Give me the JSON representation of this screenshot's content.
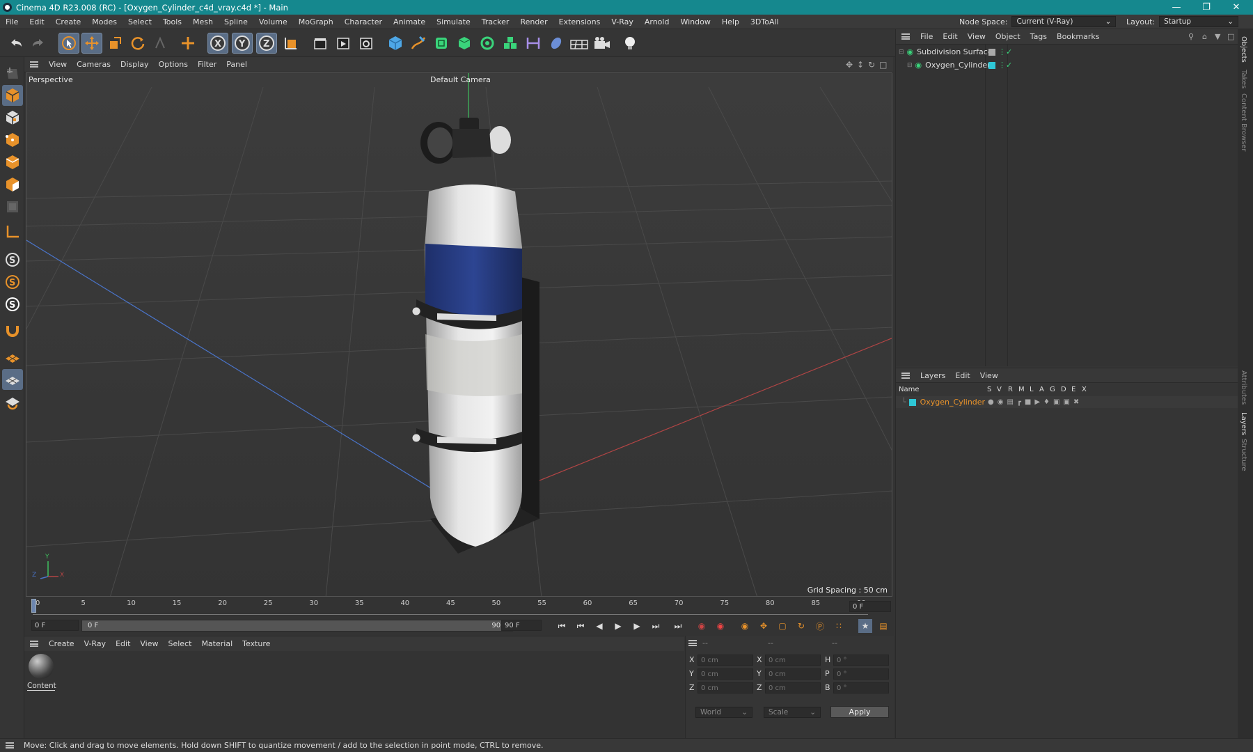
{
  "window": {
    "title": "Cinema 4D R23.008 (RC) - [Oxygen_Cylinder_c4d_vray.c4d *] - Main",
    "minimize": "—",
    "maximize": "❐",
    "close": "✕"
  },
  "menu": [
    "File",
    "Edit",
    "Create",
    "Modes",
    "Select",
    "Tools",
    "Mesh",
    "Spline",
    "Volume",
    "MoGraph",
    "Character",
    "Animate",
    "Simulate",
    "Tracker",
    "Render",
    "Extensions",
    "V-Ray",
    "Arnold",
    "Window",
    "Help",
    "3DToAll"
  ],
  "node_space": {
    "label": "Node Space:",
    "value": "Current (V-Ray)"
  },
  "layout": {
    "label": "Layout:",
    "value": "Startup"
  },
  "viewport_menu": [
    "View",
    "Cameras",
    "Display",
    "Options",
    "Filter",
    "Panel"
  ],
  "viewport": {
    "name": "Perspective",
    "camera": "Default Camera",
    "grid_spacing": "Grid Spacing : 50 cm",
    "axis_y": "Y",
    "axis_z": "Z",
    "axis_x": "X"
  },
  "timeline": {
    "ticks": [
      "0",
      "5",
      "10",
      "15",
      "20",
      "25",
      "30",
      "35",
      "40",
      "45",
      "50",
      "55",
      "60",
      "65",
      "70",
      "75",
      "80",
      "85",
      "90"
    ],
    "frame_field": "0 F"
  },
  "transport": {
    "start": "0 F",
    "range_start": "0 F",
    "range_end": "90 F",
    "end": "90 F"
  },
  "material_menu": [
    "Create",
    "V-Ray",
    "Edit",
    "View",
    "Select",
    "Material",
    "Texture"
  ],
  "materials": [
    {
      "name": "Content"
    }
  ],
  "objects_menu": [
    "File",
    "Edit",
    "View",
    "Object",
    "Tags",
    "Bookmarks"
  ],
  "objects": [
    {
      "name": "Subdivision Surface"
    },
    {
      "name": "Oxygen_Cylinder"
    }
  ],
  "layers_menu": [
    "Layers",
    "Edit",
    "View"
  ],
  "layers_header": {
    "name": "Name",
    "cols": [
      "S",
      "V",
      "R",
      "M",
      "L",
      "A",
      "G",
      "D",
      "E",
      "X"
    ]
  },
  "layers": [
    {
      "name": "Oxygen_Cylinder",
      "color": "#2ec7d6"
    }
  ],
  "coords": {
    "header": [
      "--",
      "--",
      "--"
    ],
    "rows": [
      {
        "a": "X",
        "av": "0 cm",
        "b": "X",
        "bv": "0 cm",
        "c": "H",
        "cv": "0 °"
      },
      {
        "a": "Y",
        "av": "0 cm",
        "b": "Y",
        "bv": "0 cm",
        "c": "P",
        "cv": "0 °"
      },
      {
        "a": "Z",
        "av": "0 cm",
        "b": "Z",
        "bv": "0 cm",
        "c": "B",
        "cv": "0 °"
      }
    ],
    "world": "World",
    "scale": "Scale",
    "apply": "Apply"
  },
  "side_tabs": [
    "Objects",
    "Takes",
    "Content Browser",
    "Attributes",
    "Layers",
    "Structure"
  ],
  "status": "Move: Click and drag to move elements. Hold down SHIFT to quantize movement / add to the selection in point mode, CTRL to remove.",
  "colors": {
    "titlebar": "#15888e",
    "accent_orange": "#e8922a",
    "selection": "#5a6d86",
    "layer_name": "#e8922a",
    "object_green": "#3ad47b"
  }
}
